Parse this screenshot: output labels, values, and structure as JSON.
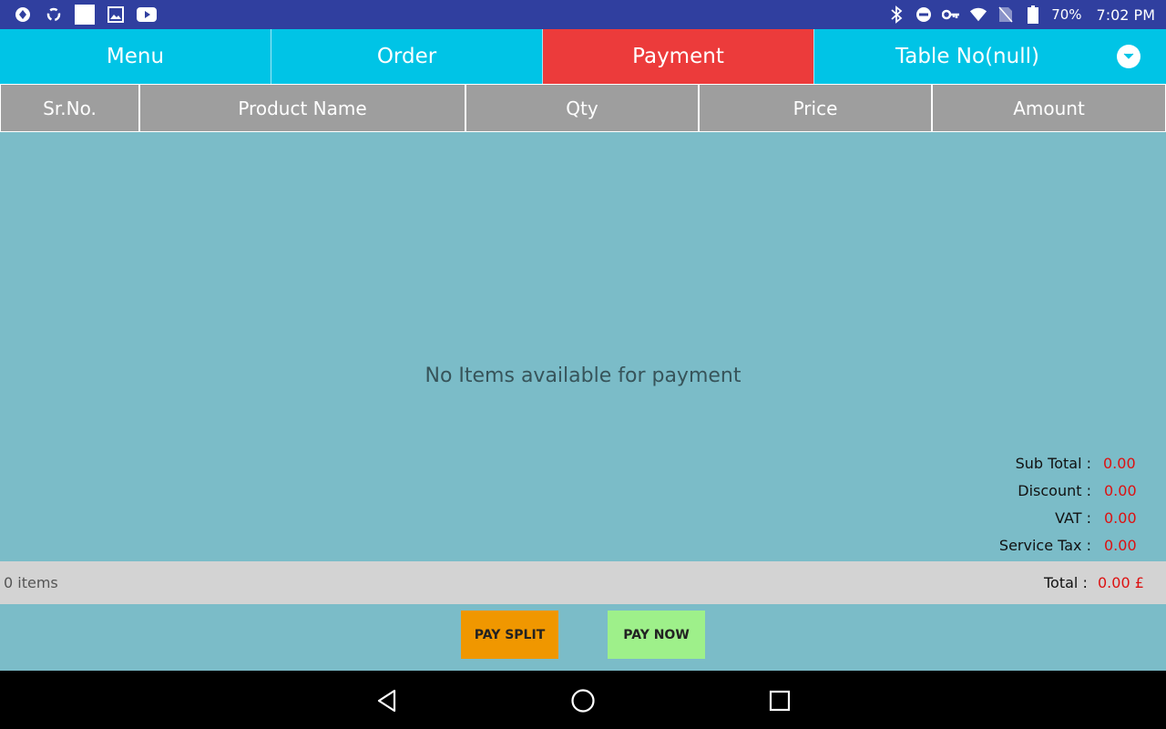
{
  "status_bar": {
    "left_icons": [
      "app-icon-1",
      "sync-icon",
      "blank-square-icon",
      "gallery-icon",
      "youtube-icon"
    ],
    "right_icons": [
      "bluetooth-icon",
      "dnd-icon",
      "vpn-key-icon",
      "wifi-icon",
      "no-sim-icon",
      "battery-icon"
    ],
    "battery": "70%",
    "time": "7:02 PM"
  },
  "tabs": [
    {
      "label": "Menu",
      "active": false
    },
    {
      "label": "Order",
      "active": false
    },
    {
      "label": "Payment",
      "active": true
    },
    {
      "label": "Table No(null)",
      "active": false,
      "dropdown": true
    }
  ],
  "table": {
    "columns": [
      "Sr.No.",
      "Product Name",
      "Qty",
      "Price",
      "Amount"
    ],
    "empty_message": "No Items available for payment"
  },
  "totals": [
    {
      "label": "Sub Total :",
      "value": "0.00"
    },
    {
      "label": "Discount :",
      "value": "0.00"
    },
    {
      "label": "VAT :",
      "value": "0.00"
    },
    {
      "label": "Service Tax :",
      "value": "0.00"
    }
  ],
  "footer": {
    "items_count": "0 items",
    "total_label": "Total :",
    "total_value": "0.00 £"
  },
  "buttons": {
    "pay_split": "PAY SPLIT",
    "pay_now": "PAY NOW"
  },
  "colors": {
    "tab_bg": "#00c4e6",
    "tab_active": "#ec3b3b",
    "content_bg": "#7bbcc8",
    "pay_split": "#f09700",
    "pay_now": "#9ef08a",
    "value_red": "#dd1111"
  }
}
